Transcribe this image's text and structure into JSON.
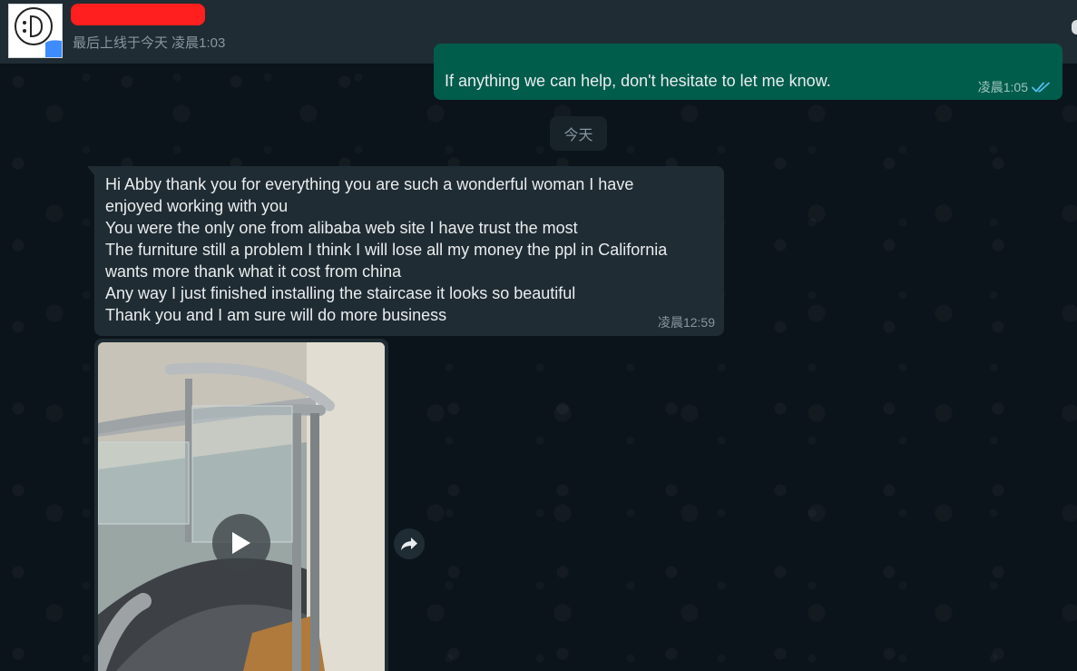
{
  "header": {
    "contact_name": "",
    "last_seen": "最后上线于今天 凌晨1:03"
  },
  "outgoing": {
    "text": "If anything we can help, don't hesitate to let me know.",
    "time": "凌晨1:05",
    "status": "read"
  },
  "date_divider": "今天",
  "incoming": {
    "lines": [
      "Hi Abby thank you for everything you are such a  wonderful woman I have",
      "enjoyed working with you",
      "You were the only one from alibaba web site I have trust the most",
      "The furniture still a problem I think I will lose all my money the ppl in California",
      "wants more thank what it cost from china",
      "Any way I just finished installing the staircase it looks so beautiful",
      "Thank you and I am sure will do more business"
    ],
    "time": "凌晨12:59"
  },
  "media": {
    "type": "video",
    "thumbnail_subject": "glass staircase with steel handrail"
  },
  "colors": {
    "chat_bg": "#0b141a",
    "header_bg": "#202c33",
    "outgoing_bubble": "#005c4b",
    "incoming_bubble": "#202c33",
    "read_ticks": "#53bdeb",
    "redaction": "#ff1f1f"
  },
  "icons": [
    "play-icon",
    "forward-icon",
    "double-check-icon"
  ]
}
